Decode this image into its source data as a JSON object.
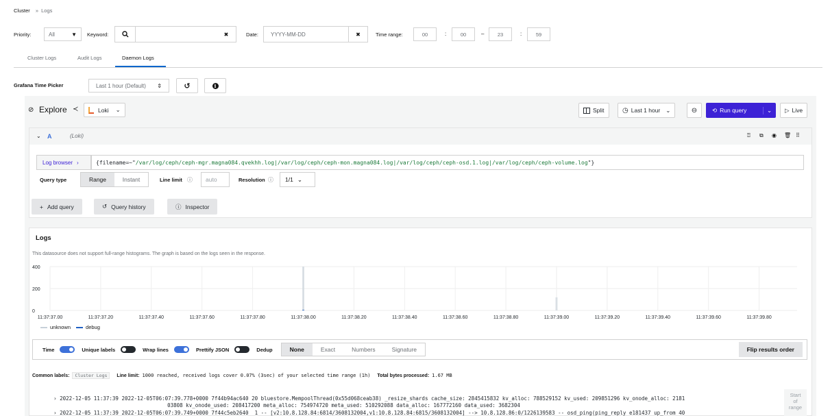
{
  "breadcrumb": {
    "root": "Cluster",
    "sep": "»",
    "current": "Logs"
  },
  "filters": {
    "priority_label": "Priority:",
    "priority_value": "All",
    "keyword_label": "Keyword:",
    "keyword_value": "",
    "date_label": "Date:",
    "date_placeholder": "YYYY-MM-DD",
    "time_range_label": "Time range:",
    "start_hour": "00",
    "start_min": "00",
    "end_hour": "23",
    "end_min": "59",
    "colon": ":",
    "dash": "–",
    "clear_glyph": "✖"
  },
  "tabs": [
    {
      "label": "Cluster Logs",
      "active": false
    },
    {
      "label": "Audit Logs",
      "active": false
    },
    {
      "label": "Daemon Logs",
      "active": true
    }
  ],
  "picker": {
    "label": "Grafana Time Picker",
    "value": "Last 1 hour (Default)",
    "arrows": "⇕"
  },
  "explore": {
    "title": "Explore",
    "datasource": "Loki",
    "split": "Split",
    "time": "Last 1 hour",
    "run_query": "Run query",
    "live": "Live"
  },
  "query": {
    "ref": "A",
    "ds": "(Loki)",
    "log_browser": "Log browser",
    "expr_prefix": "{filename=~\"",
    "expr_value": "/var/log/ceph/ceph-mgr.magna084.qvekhh.log|/var/log/ceph/ceph-mon.magna084.log|/var/log/ceph/ceph-osd.1.log|/var/log/ceph/ceph-volume.log",
    "expr_suffix": "\"}",
    "query_type_label": "Query type",
    "range": "Range",
    "instant": "Instant",
    "line_limit_label": "Line limit",
    "line_limit_placeholder": "auto",
    "resolution_label": "Resolution",
    "resolution_value": "1/1"
  },
  "actions": {
    "add_query": "Add query",
    "query_history": "Query history",
    "inspector": "Inspector"
  },
  "logs": {
    "title": "Logs",
    "notice": "This datasource does not support full-range histograms. The graph is based on the logs seen in the response.",
    "legend": [
      {
        "name": "unknown",
        "color": "#c7d0d9"
      },
      {
        "name": "debug",
        "color": "#1f60c4"
      }
    ],
    "options": {
      "time": "Time",
      "unique_labels": "Unique labels",
      "wrap_lines": "Wrap lines",
      "prettify_json": "Prettify JSON",
      "dedup": "Dedup",
      "dedup_options": [
        "None",
        "Exact",
        "Numbers",
        "Signature"
      ],
      "flip": "Flip results order"
    },
    "common_labels_label": "Common labels:",
    "common_labels_value": "Cluster Logs",
    "line_limit_label": "Line limit:",
    "line_limit_value": "1000 reached, received logs cover 0.07% (3sec) of your selected time range (1h)",
    "bytes_label": "Total bytes processed:",
    "bytes_value": "1.67 MB",
    "lines": [
      {
        "ts": "2022-12-05 11:37:39",
        "msg": "2022-12-05T06:07:39.778+0000 7f44b94ac640 20 bluestore.MempoolThread(0x55d068ceab38) _resize_shards cache_size: 2845415832 kv_alloc: 788529152 kv_used: 209851296 kv_onode_alloc: 2181",
        "cont": "03808 kv_onode_used: 208417200 meta_alloc: 754974720 meta_used: 510292088 data_alloc: 167772160 data_used: 3682304"
      },
      {
        "ts": "2022-12-05 11:37:39",
        "msg": "2022-12-05T06:07:39.749+0000 7f44c5eb2640  1 -- [v2:10.8.128.84:6814/3608132004,v1:10.8.128.84:6815/3608132004] --> 10.8.128.86:0/1226139583 -- osd_ping(ping_reply e181437 up_from 40",
        "cont": ""
      }
    ],
    "start_of_range": [
      "Start",
      "of",
      "range"
    ]
  },
  "chart_data": {
    "type": "bar",
    "title": "",
    "xlabel": "",
    "ylabel": "",
    "ylim": [
      0,
      400
    ],
    "yticks": [
      0,
      200,
      400
    ],
    "xticks": [
      "11:37:37.00",
      "11:37:37.20",
      "11:37:37.40",
      "11:37:37.60",
      "11:37:37.80",
      "11:37:38.00",
      "11:37:38.20",
      "11:37:38.40",
      "11:37:38.60",
      "11:37:38.80",
      "11:37:39.00",
      "11:37:39.20",
      "11:37:39.40",
      "11:37:39.60",
      "11:37:39.80"
    ],
    "x_domain": [
      37.0,
      39.95
    ],
    "series": [
      {
        "name": "unknown",
        "color": "#c7d0d9",
        "points": [
          [
            38.0,
            400
          ],
          [
            39.0,
            120
          ]
        ]
      },
      {
        "name": "debug",
        "color": "#1f60c4",
        "points": [
          [
            38.0,
            5
          ],
          [
            39.0,
            0
          ]
        ]
      }
    ],
    "grid": true,
    "legend": "bottom-left"
  }
}
